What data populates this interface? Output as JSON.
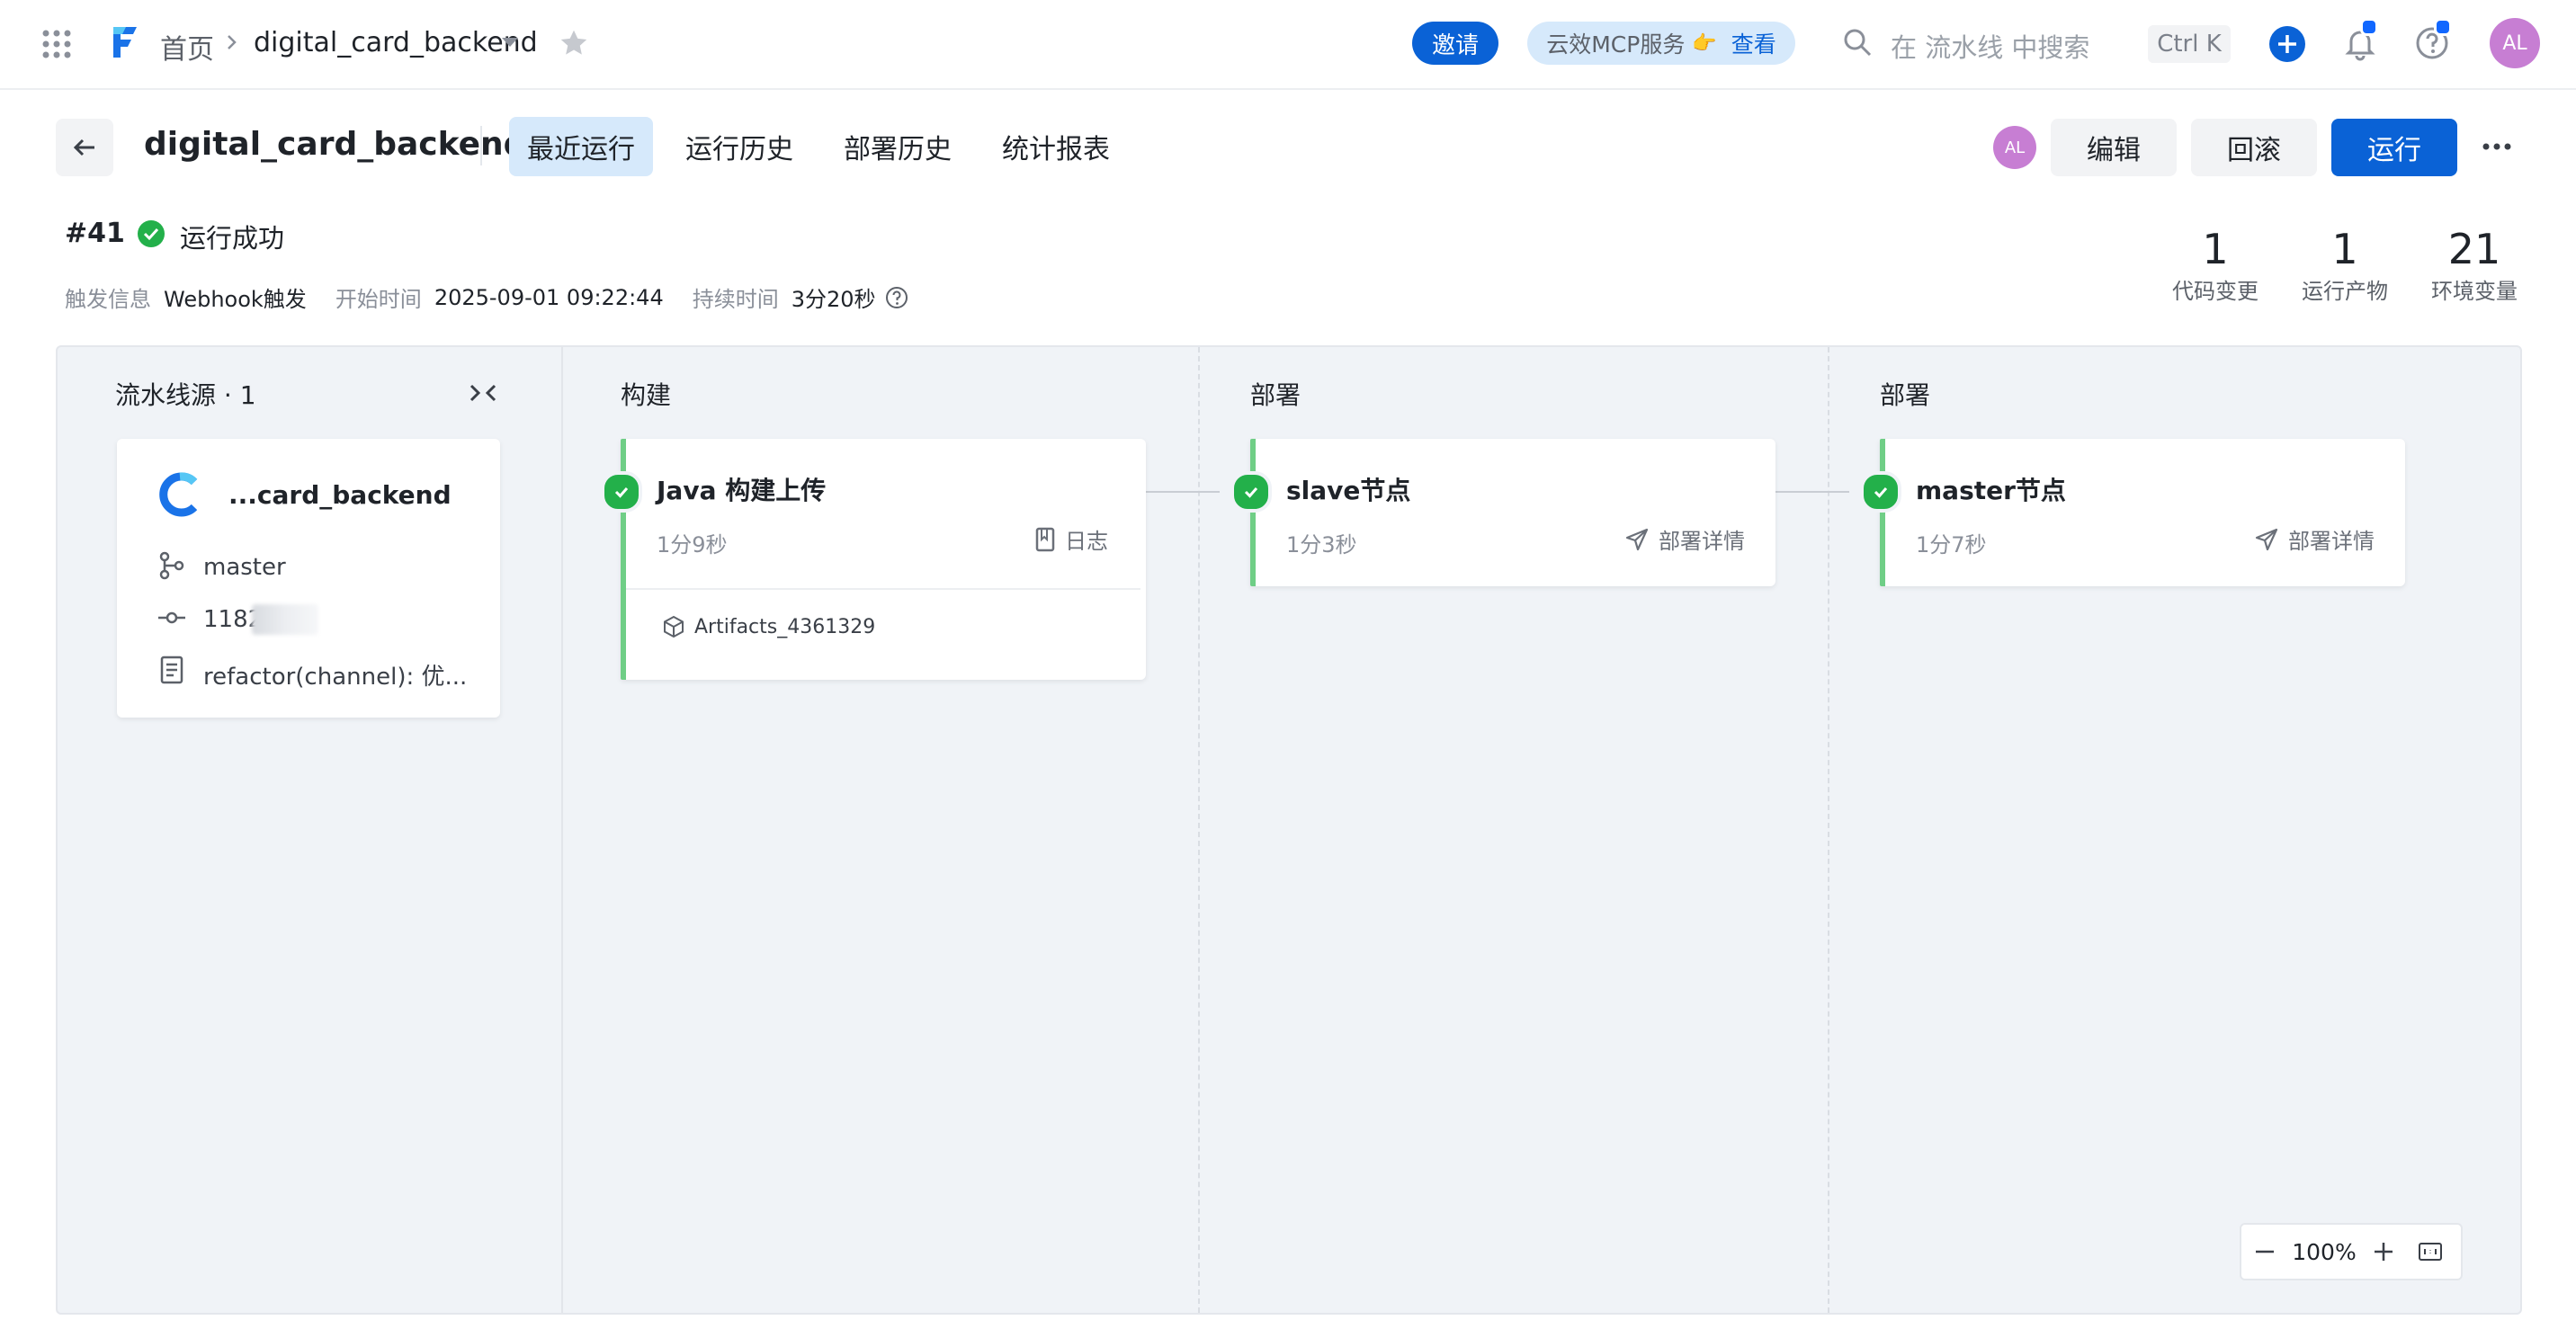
{
  "topbar": {
    "home": "首页",
    "project": "digital_card_backend",
    "invite": "邀请",
    "mcp_service": "云效MCP服务",
    "mcp_emoji": "👉",
    "mcp_view": "查看",
    "search_placeholder": "在 流水线 中搜索",
    "shortcut": "Ctrl K",
    "avatar": "AL"
  },
  "header": {
    "title": "digital_card_backend",
    "tabs": [
      "最近运行",
      "运行历史",
      "部署历史",
      "统计报表"
    ],
    "active_tab": 0,
    "avatar": "AL",
    "edit": "编辑",
    "rollback": "回滚",
    "run": "运行"
  },
  "run": {
    "number": "#41",
    "status": "运行成功",
    "trigger_label": "触发信息",
    "trigger_value": "Webhook触发",
    "start_label": "开始时间",
    "start_value": "2025-09-01 09:22:44",
    "duration_label": "持续时间",
    "duration_value": "3分20秒"
  },
  "stats": [
    {
      "value": "1",
      "label": "代码变更"
    },
    {
      "value": "1",
      "label": "运行产物"
    },
    {
      "value": "21",
      "label": "环境变量"
    }
  ],
  "source": {
    "header": "流水线源 · 1",
    "repo": "...card_backend",
    "branch": "master",
    "commit": "1182",
    "message": "refactor(channel): 优..."
  },
  "stages": [
    {
      "title": "构建",
      "job": {
        "name": "Java 构建上传",
        "time": "1分9秒",
        "action": "日志",
        "artifact": "Artifacts_4361329"
      }
    },
    {
      "title": "部署",
      "job": {
        "name": "slave节点",
        "time": "1分3秒",
        "action": "部署详情"
      }
    },
    {
      "title": "部署",
      "job": {
        "name": "master节点",
        "time": "1分7秒",
        "action": "部署详情"
      }
    }
  ],
  "zoom": {
    "level": "100%"
  },
  "colors": {
    "primary": "#0a62d6",
    "success": "#23b04a",
    "active_tab_bg": "#d6e9fb",
    "avatar": "#c77ed3"
  }
}
